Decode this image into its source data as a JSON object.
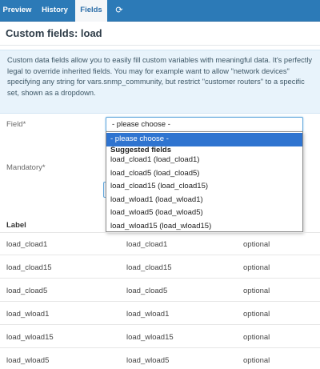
{
  "tabs": [
    {
      "label": "Preview",
      "active": false
    },
    {
      "label": "History",
      "active": false
    },
    {
      "label": "Fields",
      "active": true
    },
    {
      "label": "⟳",
      "icon": "refresh-icon",
      "active": false
    }
  ],
  "page": {
    "title": "Custom fields: load"
  },
  "info": {
    "text": "Custom data fields allow you to easily fill custom variables with meaningful data. It's perfectly legal to override inherited fields. You may for example want to allow \"network devices\" specifying any string for vars.snmp_community, but restrict \"customer routers\" to a specific set, shown as a dropdown."
  },
  "form": {
    "field_label": "Field*",
    "field_value": "- please choose -",
    "mandatory_label": "Mandatory*"
  },
  "dropdown": {
    "placeholder": "- please choose -",
    "group_label": "Suggested fields",
    "options": [
      "load_cload1 (load_cload1)",
      "load_cload5 (load_cload5)",
      "load_cload15 (load_cload15)",
      "load_wload1 (load_wload1)",
      "load_wload5 (load_wload5)",
      "load_wload15 (load_wload15)"
    ]
  },
  "table": {
    "header": "Label",
    "rows": [
      [
        "load_cload1",
        "load_cload1",
        "optional"
      ],
      [
        "load_cload15",
        "load_cload15",
        "optional"
      ],
      [
        "load_cload5",
        "load_cload5",
        "optional"
      ],
      [
        "load_wload1",
        "load_wload1",
        "optional"
      ],
      [
        "load_wload15",
        "load_wload15",
        "optional"
      ],
      [
        "load_wload5",
        "load_wload5",
        "optional"
      ]
    ]
  },
  "colors": {
    "tab_bar": "#2c7ab7",
    "info_bg": "#e8f3fb",
    "selected_option": "#2f74d0",
    "select_border": "#62a7dc"
  }
}
